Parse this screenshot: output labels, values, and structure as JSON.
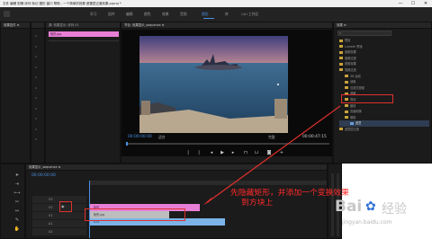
{
  "window": {
    "title": "文件 编辑 剪辑 序列 标记 图形 窗口 帮助 - 一个简单的效果·遮罩层过渡效果.prproj *",
    "minimize": "—",
    "maximize": "☐",
    "close": "✕"
  },
  "workspace_tabs": [
    "学习",
    "组件",
    "编辑",
    "颜色",
    "效果",
    "音频",
    "图形",
    "库",
    "Ctrl 工作区"
  ],
  "active_tab_index": 6,
  "source_panel": {
    "title": "效果控件 ≡",
    "secondary": "音频剪辑混合器",
    "left_values": [
      "0",
      "0",
      "0",
      "0",
      "0",
      "0",
      "0",
      "0",
      "0",
      "0",
      "0"
    ]
  },
  "project_panel": {
    "title": "源: 效果显示: 序列 01",
    "clip_label": "矩形.jpg",
    "numbers": [
      "00:00:00:00",
      "00:00:00:00"
    ]
  },
  "program_monitor": {
    "title": "节目: 效果显示_sequence ≡",
    "timecode_left": "00:00:00:00",
    "fit": "适合",
    "scale": "完整",
    "timecode_right": "00:00:47:15"
  },
  "effects_panel": {
    "title": "效果 ≡",
    "search_placeholder": "",
    "items": [
      "预设",
      "Lumetri 预设",
      "音频效果",
      "音频过渡",
      "视频效果",
      "视频过渡",
      "3D 运动",
      "划像",
      "沉浸式视频",
      "溶解",
      "滑动",
      "缩放",
      "页面剥落",
      "擦除",
      "遮罩",
      "遮罩层过渡"
    ],
    "selected_index": 14
  },
  "timeline": {
    "title": "效果显示_sequence ≡",
    "timecode": "00:00:00:00",
    "track_labels": [
      "V3",
      "V2",
      "V1",
      "A1",
      "A2",
      "A3"
    ],
    "clip_pink": "矩形",
    "clip_gray": "矩形.jpg",
    "clip_v1": "A15",
    "toggle_label": "V1"
  },
  "annotation": {
    "line1": "先隐藏矩形，并添加一个变换效果",
    "line2": "到方块上"
  },
  "watermark": {
    "brand": "Bai",
    "brand2": "经验",
    "domain": "jingyan.baidu.com"
  },
  "colors": {
    "accent": "#4a90e2",
    "clip_pink": "#e87fd6",
    "clip_blue": "#7bb3e8",
    "annotation_red": "#ff2a2a"
  }
}
